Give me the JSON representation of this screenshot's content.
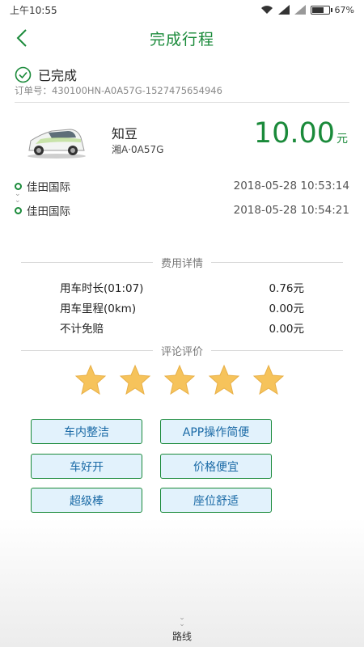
{
  "status_bar": {
    "time": "上午10:55",
    "battery": "67%",
    "battery_level": 0.67,
    "icons": [
      "wifi-icon",
      "signal-icon",
      "signal-icon",
      "battery-icon"
    ]
  },
  "nav": {
    "title": "完成行程",
    "back_icon": "chevron-left-icon"
  },
  "order": {
    "status": "已完成",
    "number": "订单号：430100HN-A0A57G-1527475654946"
  },
  "car": {
    "name": "知豆",
    "plate": "湘A·0A57G",
    "price": "10.00",
    "price_unit": "元"
  },
  "trip": {
    "start": {
      "place": "佳田国际",
      "time": "2018-05-28 10:53:14"
    },
    "end": {
      "place": "佳田国际",
      "time": "2018-05-28 10:54:21"
    }
  },
  "fees": {
    "header": "费用详情",
    "rows": [
      {
        "label": "用车时长(01:07)",
        "value": "0.76元"
      },
      {
        "label": "用车里程(0km)",
        "value": "0.00元"
      },
      {
        "label": "不计免赔",
        "value": "0.00元"
      }
    ]
  },
  "rating": {
    "header": "评论评价",
    "stars": 5,
    "star_color": "#f6c35b",
    "tags": [
      "车内整洁",
      "APP操作简便",
      "车好开",
      "价格便宜",
      "超级棒",
      "座位舒适"
    ]
  },
  "route": {
    "label": "路线"
  },
  "colors": {
    "accent": "#1a8a3a",
    "tag_bg": "#e2f2fc",
    "tag_text": "#1a6aa6"
  }
}
